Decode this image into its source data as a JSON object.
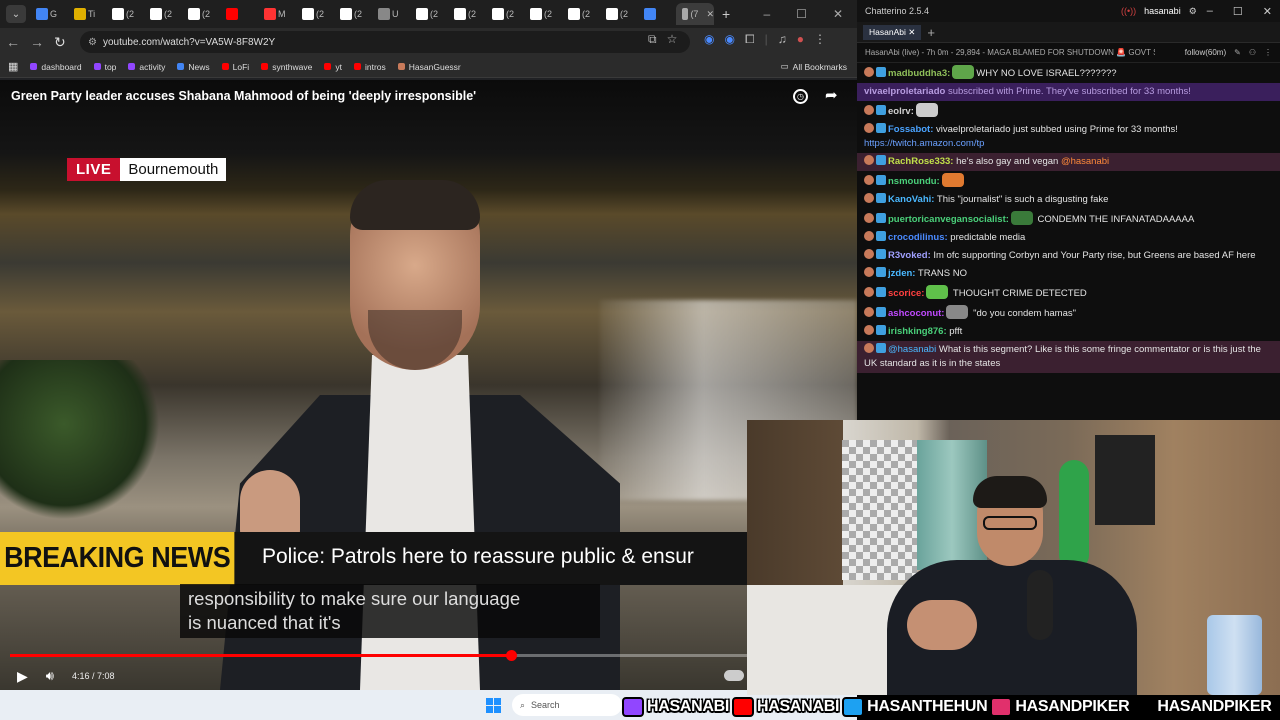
{
  "browser": {
    "tabs": [
      {
        "label": "G",
        "color": "#4285f4"
      },
      {
        "label": "Ti",
        "color": "#e0b000"
      },
      {
        "label": "(2",
        "color": "#ffffff"
      },
      {
        "label": "(2",
        "color": "#ffffff"
      },
      {
        "label": "(2",
        "color": "#ffffff"
      },
      {
        "label": "",
        "color": "#ff0000"
      },
      {
        "label": "M",
        "color": "#ff3333"
      },
      {
        "label": "(2",
        "color": "#ffffff"
      },
      {
        "label": "(2",
        "color": "#ffffff"
      },
      {
        "label": "U",
        "color": "#888888"
      },
      {
        "label": "(2",
        "color": "#ffffff"
      },
      {
        "label": "(2",
        "color": "#ffffff"
      },
      {
        "label": "(2",
        "color": "#ffffff"
      },
      {
        "label": "(2",
        "color": "#ffffff"
      },
      {
        "label": "(2",
        "color": "#ffffff"
      },
      {
        "label": "(2",
        "color": "#ffffff"
      },
      {
        "label": "",
        "color": "#4285f4"
      },
      {
        "label": "(7",
        "color": "#aaaaaa",
        "active": true
      }
    ],
    "url": "youtube.com/watch?v=VA5W-8F8W2Y",
    "bookmarks": [
      {
        "label": "dashboard",
        "color": "#9146ff"
      },
      {
        "label": "top",
        "color": "#9146ff"
      },
      {
        "label": "activity",
        "color": "#9146ff"
      },
      {
        "label": "News",
        "color": "#4285f4"
      },
      {
        "label": "LoFi",
        "color": "#ff0000"
      },
      {
        "label": "synthwave",
        "color": "#ff0000"
      },
      {
        "label": "yt",
        "color": "#ff0000"
      },
      {
        "label": "intros",
        "color": "#ff0000"
      },
      {
        "label": "HasanGuessr",
        "color": "#c87a5a"
      }
    ],
    "all_bookmarks": "All Bookmarks"
  },
  "video": {
    "title": "Green Party leader accuses Shabana Mahmood of being 'deeply irresponsible'",
    "live_label": "LIVE",
    "location": "Bournemouth",
    "breaking_label": "BREAKING NEWS",
    "ticker": "Police: Patrols here to reassure public & ensur",
    "caption_line1": "responsibility to make sure our language",
    "caption_line2": "is nuanced that it's",
    "time": "4:16 / 7:08",
    "progress": 0.68
  },
  "taskbar": {
    "search_placeholder": "Search"
  },
  "chat": {
    "app_title": "Chatterino 2.5.4",
    "user": "hasanabi",
    "tab_label": "HasanAbi",
    "status": "HasanAbi (live) - 7h 0m - 29,894 - MAGA BLAMED FOR SHUTDOWN 🚨 GOVT SHU",
    "follow": "follow(60m)",
    "messages": [
      {
        "user": "madbuddha3:",
        "user_color": "#8fbf5a",
        "text": "WHY NO LOVE ISRAEL???????",
        "emote": "#5fa64a"
      },
      {
        "type": "sub",
        "user": "vivaelproletariado",
        "text": " subscribed with Prime. They've subscribed for 33 months!"
      },
      {
        "user": "eolrv:",
        "user_color": "#d0d0d0",
        "text": "",
        "emote": "#cccccc"
      },
      {
        "user": "Fossabot:",
        "user_color": "#4aa3ff",
        "text": " vivaelproletariado just subbed using Prime for 33 months!",
        "link": "https://twitch.amazon.com/tp"
      },
      {
        "type": "highlight",
        "user": "RachRose333:",
        "user_color": "#c1e04a",
        "text": " he's also gay and vegan ",
        "mention": "@hasanabi"
      },
      {
        "user": "nsmoundu:",
        "user_color": "#4ad07a",
        "text": "",
        "emote": "#e07a30"
      },
      {
        "user": "KanoVahi:",
        "user_color": "#4ab8ff",
        "text": " This \"journalist\" is such a disgusting fake"
      },
      {
        "user": "puertoricanvegansocialist:",
        "user_color": "#4ad07a",
        "text": " CONDEMN THE INFANATADAAAAA",
        "emote": "#3a7a3a"
      },
      {
        "user": "crocodilinus:",
        "user_color": "#4a8aff",
        "text": " predictable media"
      },
      {
        "user": "R3voked:",
        "user_color": "#a0a0ff",
        "text": " Im ofc supporting Corbyn and Your Party rise, but Greens are based AF here"
      },
      {
        "user": "jzden:",
        "user_color": "#4ab8ff",
        "text": " TRANS NO"
      },
      {
        "user": "scorice:",
        "user_color": "#ff4040",
        "text": " THOUGHT CRIME DETECTED",
        "emote": "#5fc04a"
      },
      {
        "user": "ashcoconut:",
        "user_color": "#c04aff",
        "text": " \"do you condem hamas\"",
        "emote": "#888888"
      },
      {
        "user": "irishking876:",
        "user_color": "#4ad07a",
        "text": " pfft"
      },
      {
        "type": "highlight",
        "user": "",
        "user_color": "#ff4040",
        "text": " What is this segment? Like is this some fringe commentator or is this just the UK standard as it is in the states",
        "mention": "@hasanabi"
      }
    ]
  },
  "socials": [
    {
      "icon": "twitch-icon",
      "label": "HASANABI",
      "color": "#9146ff"
    },
    {
      "icon": "youtube-icon",
      "label": "HASANABI",
      "color": "#ff0000"
    },
    {
      "icon": "twitter-icon",
      "label": "HASANTHEHUN",
      "color": "#1da1f2"
    },
    {
      "icon": "instagram-icon",
      "label": "HASANDPIKER",
      "color": "#e1306c"
    },
    {
      "icon": "tiktok-icon",
      "label": "HASANDPIKER",
      "color": "#000000"
    }
  ]
}
